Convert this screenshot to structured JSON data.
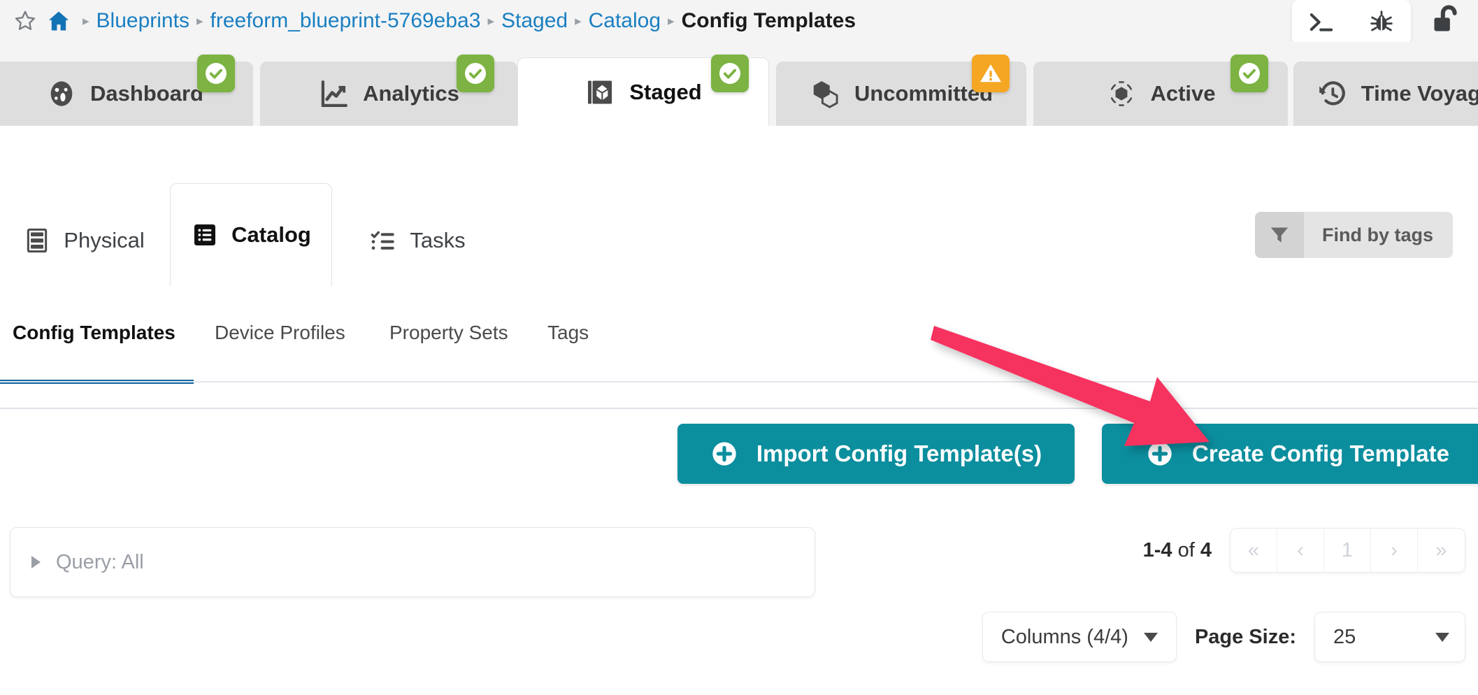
{
  "breadcrumb": {
    "star_icon": "star-outline-icon",
    "home_icon": "home-icon",
    "separator": "▸",
    "items": [
      {
        "label": "Blueprints",
        "current": false
      },
      {
        "label": "freeform_blueprint-5769eba3",
        "current": false
      },
      {
        "label": "Staged",
        "current": false
      },
      {
        "label": "Catalog",
        "current": false
      },
      {
        "label": "Config Templates",
        "current": true
      }
    ]
  },
  "topright": {
    "terminal_icon": "terminal-icon",
    "bug_icon": "bug-icon",
    "lock_icon": "unlock-icon"
  },
  "main_tabs": [
    {
      "label": "Dashboard",
      "icon": "gauge-icon",
      "badge": "ok",
      "active": false
    },
    {
      "label": "Analytics",
      "icon": "line-chart-icon",
      "badge": "ok",
      "active": false
    },
    {
      "label": "Staged",
      "icon": "staged-cube-icon",
      "badge": "ok",
      "active": true
    },
    {
      "label": "Uncommitted",
      "icon": "cubes-icon",
      "badge": "warn",
      "active": false
    },
    {
      "label": "Active",
      "icon": "active-cube-icon",
      "badge": "ok",
      "active": false
    },
    {
      "label": "Time Voyager",
      "icon": "history-icon",
      "badge": "none",
      "active": false
    }
  ],
  "section_tabs": [
    {
      "label": "Physical",
      "icon": "server-rack-icon",
      "active": false
    },
    {
      "label": "Catalog",
      "icon": "catalog-list-icon",
      "active": true
    },
    {
      "label": "Tasks",
      "icon": "task-list-icon",
      "active": false
    }
  ],
  "find_by_tags": {
    "label": "Find by tags",
    "icon": "filter-funnel-icon"
  },
  "sub_tabs": [
    {
      "label": "Config Templates",
      "active": true
    },
    {
      "label": "Device Profiles",
      "active": false
    },
    {
      "label": "Property Sets",
      "active": false
    },
    {
      "label": "Tags",
      "active": false
    }
  ],
  "actions": {
    "import": {
      "label": "Import Config Template(s)",
      "icon": "plus-circle-icon"
    },
    "create": {
      "label": "Create Config Template",
      "icon": "plus-circle-icon"
    }
  },
  "query": {
    "label": "Query: All",
    "caret_icon": "chevron-right-icon"
  },
  "pagination": {
    "range_prefix": "1-4",
    "range_middle": " of ",
    "range_total": "4",
    "first": "«",
    "prev": "‹",
    "current_page": "1",
    "next": "›",
    "last": "»"
  },
  "bottom_controls": {
    "columns_label": "Columns (4/4)",
    "page_size_label": "Page Size:",
    "page_size_value": "25"
  },
  "annotation": {
    "type": "arrow",
    "color": "#f6305e",
    "points_to": "Create Config Template"
  },
  "colors": {
    "accent_teal": "#0b8e9e",
    "link_blue": "#1a7fc1",
    "badge_green": "#7cb342",
    "badge_orange": "#f5a623",
    "indicator_blue": "#1266a2",
    "annotation_pink": "#f6305e"
  }
}
